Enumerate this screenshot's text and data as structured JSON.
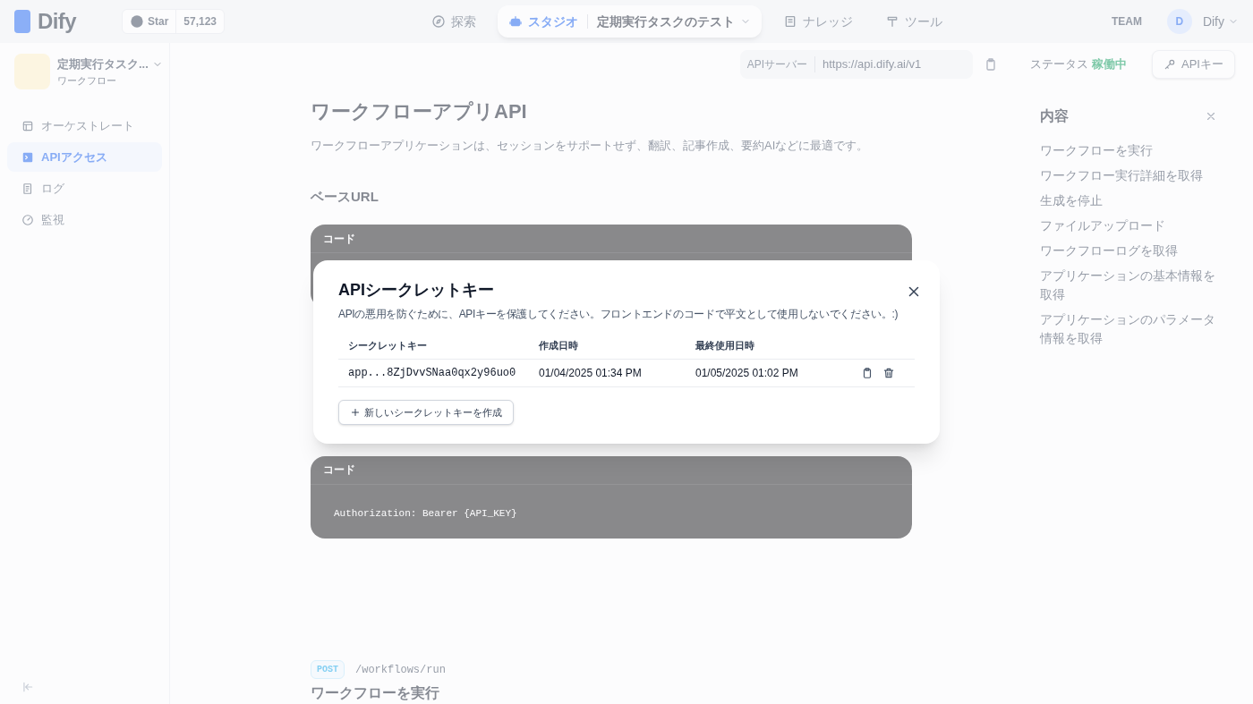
{
  "header": {
    "logo": "Dify",
    "star_label": "Star",
    "star_count": "57,123",
    "nav": [
      {
        "kind": "explore",
        "label": "探索",
        "selected": false
      },
      {
        "kind": "studio",
        "label": "スタジオ",
        "app": "定期実行タスクのテスト",
        "selected": true
      },
      {
        "kind": "knowledge",
        "label": "ナレッジ",
        "selected": false
      },
      {
        "kind": "tools",
        "label": "ツール",
        "selected": false
      }
    ],
    "team": "TEAM",
    "user": {
      "initial": "D",
      "name": "Dify"
    }
  },
  "sidebar": {
    "app": {
      "name": "定期実行タスク...",
      "type": "ワークフロー"
    },
    "items": [
      {
        "kind": "orchestrate",
        "label": "オーケストレート",
        "selected": false
      },
      {
        "kind": "api",
        "label": "APIアクセス",
        "selected": true
      },
      {
        "kind": "logs",
        "label": "ログ",
        "selected": false
      },
      {
        "kind": "monitor",
        "label": "監視",
        "selected": false
      }
    ]
  },
  "toolbar": {
    "api_server_label": "APIサーバー",
    "api_server_url": "https://api.dify.ai/v1",
    "status_label": "ステータス",
    "status_value": "稼働中",
    "api_key_button": "APIキー"
  },
  "content": {
    "title": "ワークフローアプリAPI",
    "description": "ワークフローアプリケーションは、セッションをサポートせず、翻訳、記事作成、要約AIなどに最適です。",
    "base_url_heading": "ベースURL",
    "code_blocks": [
      {
        "label": "コード"
      },
      {
        "label": "コード",
        "code": "Authorization: Bearer {API_KEY}"
      }
    ],
    "endpoint": {
      "method": "POST",
      "path": "/workflows/run",
      "title": "ワークフローを実行"
    }
  },
  "toc": {
    "title": "内容",
    "items": [
      "ワークフローを実行",
      "ワークフロー実行詳細を取得",
      "生成を停止",
      "ファイルアップロード",
      "ワークフローログを取得",
      "アプリケーションの基本情報を取得",
      "アプリケーションのパラメータ情報を取得"
    ]
  },
  "modal": {
    "title": "APIシークレットキー",
    "description": "APIの悪用を防ぐために、APIキーを保護してください。フロントエンドのコードで平文として使用しないでください。:)",
    "columns": [
      "シークレットキー",
      "作成日時",
      "最終使用日時"
    ],
    "keys": [
      {
        "key": "app...8ZjDvvSNaa0qx2y96uo0",
        "created": "01/04/2025 01:34 PM",
        "last_used": "01/05/2025 01:02 PM"
      }
    ],
    "create_button": "新しいシークレットキーを作成"
  }
}
